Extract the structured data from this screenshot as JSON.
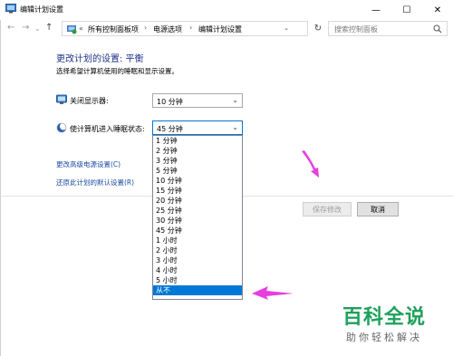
{
  "window": {
    "title": "编辑计划设置",
    "minimize": "—",
    "maximize": "☐",
    "close": "✕"
  },
  "address_bar": {
    "back": "←",
    "forward": "→",
    "up_dropdown": "⌄",
    "up": "↑",
    "overflow": "«",
    "crumbs": [
      "所有控制面板项",
      "电源选项",
      "编辑计划设置"
    ],
    "separator": "›",
    "dropdown": "⌄",
    "refresh": "↻",
    "search_placeholder": "搜索控制面板"
  },
  "main": {
    "title": "更改计划的设置: 平衡",
    "description": "选择希望计算机使用的睡眠和显示设置。",
    "display_off": {
      "label": "关闭显示器:",
      "value": "10 分钟"
    },
    "sleep": {
      "label": "使计算机进入睡眠状态:",
      "value": "45 分钟",
      "options": [
        "1 分钟",
        "2 分钟",
        "3 分钟",
        "5 分钟",
        "10 分钟",
        "15 分钟",
        "20 分钟",
        "25 分钟",
        "30 分钟",
        "45 分钟",
        "1 小时",
        "2 小时",
        "3 小时",
        "4 小时",
        "5 小时",
        "从不"
      ],
      "highlighted": "从不"
    },
    "links": {
      "advanced": "更改高级电源设置(C)",
      "restore": "还原此计划的默认设置(R)"
    }
  },
  "buttons": {
    "save": "保存修改",
    "cancel": "取消"
  },
  "watermark": {
    "title": "百科全说",
    "subtitle": "助你轻松解决"
  },
  "colors": {
    "accent": "#0078d7",
    "title_blue": "#1e3287",
    "link_blue": "#1a4ca2",
    "annotation_magenta": "#e83ee0",
    "watermark_green": "#1ea05a"
  }
}
